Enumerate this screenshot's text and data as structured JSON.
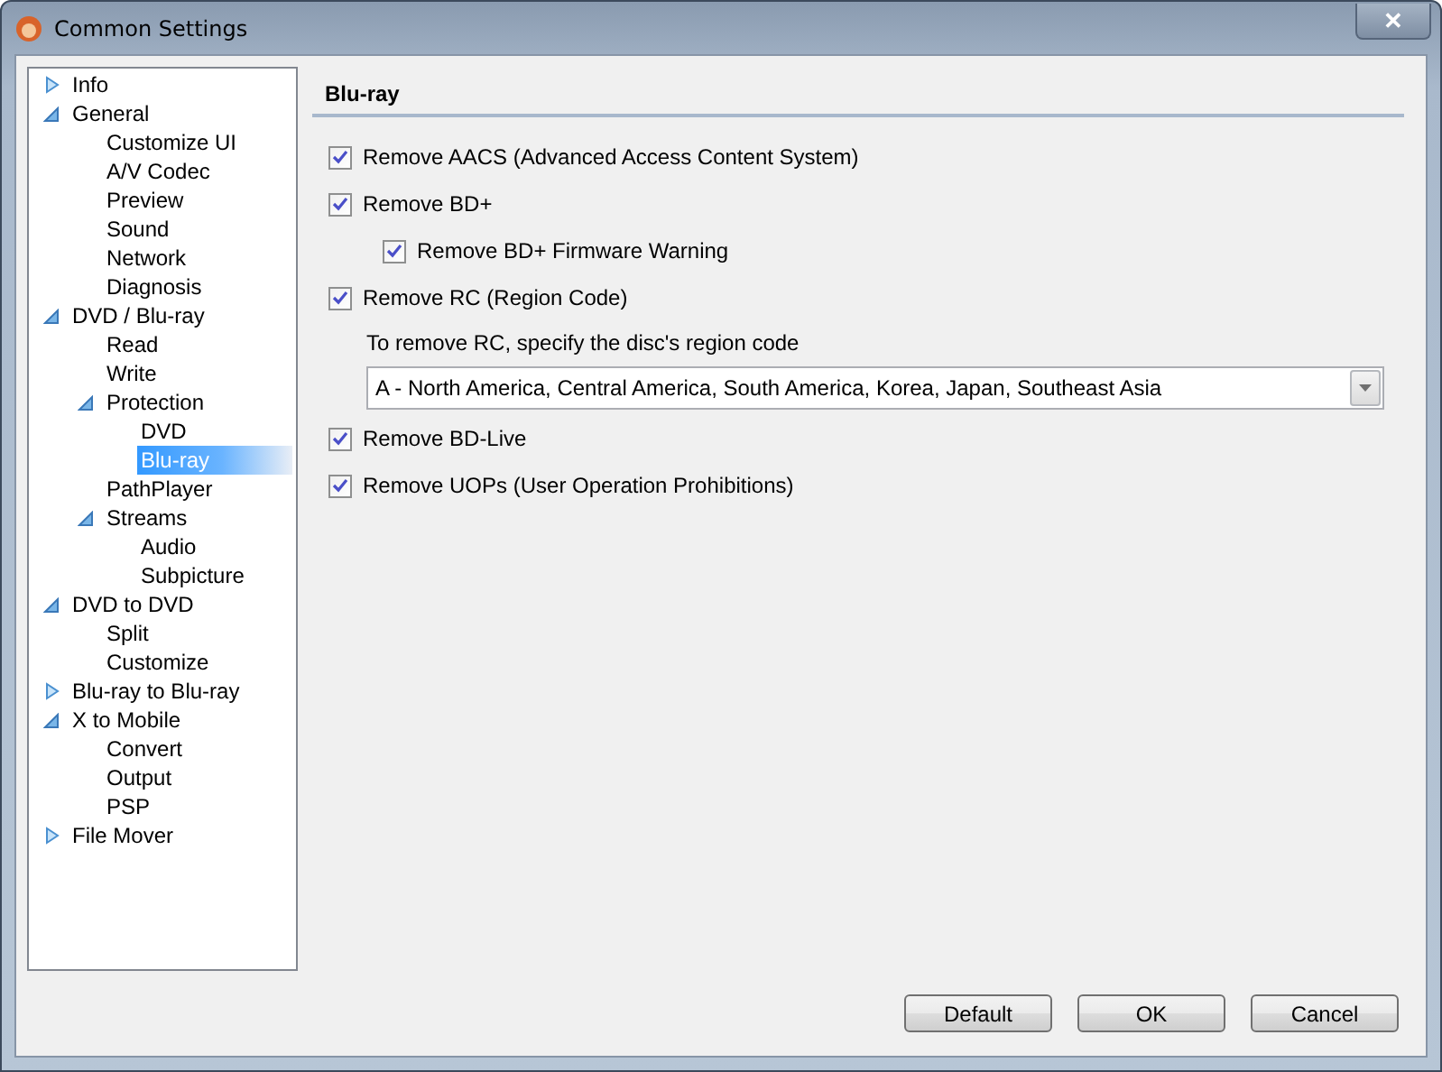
{
  "window": {
    "title": "Common Settings",
    "close": "✕"
  },
  "tree": [
    {
      "label": "Info",
      "expanded": false,
      "selected": false
    },
    {
      "label": "General",
      "expanded": true,
      "selected": false,
      "children": [
        {
          "label": "Customize UI",
          "selected": false
        },
        {
          "label": "A/V Codec",
          "selected": false
        },
        {
          "label": "Preview",
          "selected": false
        },
        {
          "label": "Sound",
          "selected": false
        },
        {
          "label": "Network",
          "selected": false
        },
        {
          "label": "Diagnosis",
          "selected": false
        }
      ]
    },
    {
      "label": "DVD / Blu-ray",
      "expanded": true,
      "selected": false,
      "children": [
        {
          "label": "Read",
          "selected": false
        },
        {
          "label": "Write",
          "selected": false
        },
        {
          "label": "Protection",
          "expanded": true,
          "selected": false,
          "children": [
            {
              "label": "DVD",
              "selected": false
            },
            {
              "label": "Blu-ray",
              "selected": true
            }
          ]
        },
        {
          "label": "PathPlayer",
          "selected": false
        },
        {
          "label": "Streams",
          "expanded": true,
          "selected": false,
          "children": [
            {
              "label": "Audio",
              "selected": false
            },
            {
              "label": "Subpicture",
              "selected": false
            }
          ]
        }
      ]
    },
    {
      "label": "DVD to DVD",
      "expanded": true,
      "selected": false,
      "children": [
        {
          "label": "Split",
          "selected": false
        },
        {
          "label": "Customize",
          "selected": false
        }
      ]
    },
    {
      "label": "Blu-ray to Blu-ray",
      "expanded": false,
      "selected": false
    },
    {
      "label": "X to Mobile",
      "expanded": true,
      "selected": false,
      "children": [
        {
          "label": "Convert",
          "selected": false
        },
        {
          "label": "Output",
          "selected": false
        },
        {
          "label": "PSP",
          "selected": false
        }
      ]
    },
    {
      "label": "File Mover",
      "expanded": false,
      "selected": false
    }
  ],
  "section": {
    "title": "Blu-ray"
  },
  "options": [
    {
      "kind": "checkbox",
      "label": "Remove AACS (Advanced Access Content System)",
      "checked": true
    },
    {
      "kind": "checkbox",
      "label": "Remove BD+",
      "checked": true,
      "children": [
        {
          "kind": "checkbox",
          "label": "Remove BD+ Firmware Warning",
          "checked": true
        }
      ]
    },
    {
      "kind": "checkbox",
      "label": "Remove RC (Region Code)",
      "checked": true,
      "children": [
        {
          "kind": "label",
          "label": "To remove RC, specify the disc's region code"
        },
        {
          "kind": "dropdown",
          "value": "A - North America, Central America, South America, Korea, Japan, Southeast Asia"
        }
      ]
    },
    {
      "kind": "checkbox",
      "label": "Remove BD-Live",
      "checked": true
    },
    {
      "kind": "checkbox",
      "label": "Remove UOPs (User Operation Prohibitions)",
      "checked": true
    }
  ],
  "buttons": [
    "Default",
    "OK",
    "Cancel"
  ]
}
